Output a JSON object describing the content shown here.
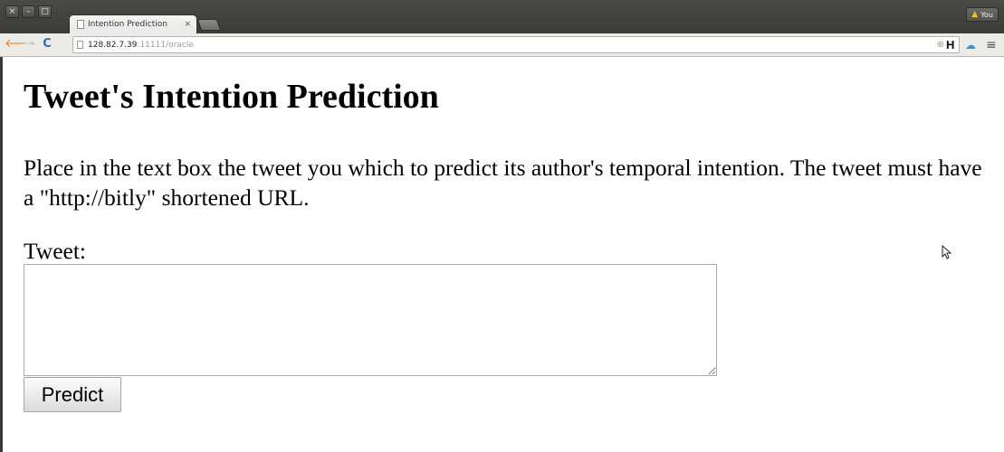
{
  "browser": {
    "window_controls": [
      "×",
      "–",
      "□"
    ],
    "tab": {
      "title": "Intention Prediction",
      "close_glyph": "×"
    },
    "profile_badge": {
      "warning_glyph": "▲",
      "label": "You"
    },
    "toolbar": {
      "back_glyph": "🡐",
      "forward_glyph": "→",
      "reload_glyph": "C",
      "url_host": "128.82.7.39",
      "url_rest": ":11111/oracle",
      "zoom_glyph": "⊕",
      "star_glyph": "☆",
      "extensions": {
        "h_label": "H",
        "cloud_glyph": "☁",
        "menu_glyph": "≡"
      }
    },
    "colors": {
      "titlebar": "#3e3e3b",
      "tab_bg": "#f0f0ee",
      "toolbar_bg": "#ecebe8",
      "back_arrow": "#f07a28",
      "reload": "#2f6fb6",
      "cloud": "#3b8fd6",
      "warning": "#f0c020"
    }
  },
  "page": {
    "title": "Tweet's Intention Prediction",
    "instructions": "Place in the text box the tweet you which to predict its author's temporal intention. The tweet must have a \"http://bitly\" shortened URL.",
    "form": {
      "tweet_label": "Tweet:",
      "tweet_value": "",
      "predict_label": "Predict"
    }
  },
  "icons": {
    "tab_page": "document-icon",
    "omnibox_page": "document-icon",
    "cursor": "mouse-pointer-icon"
  }
}
